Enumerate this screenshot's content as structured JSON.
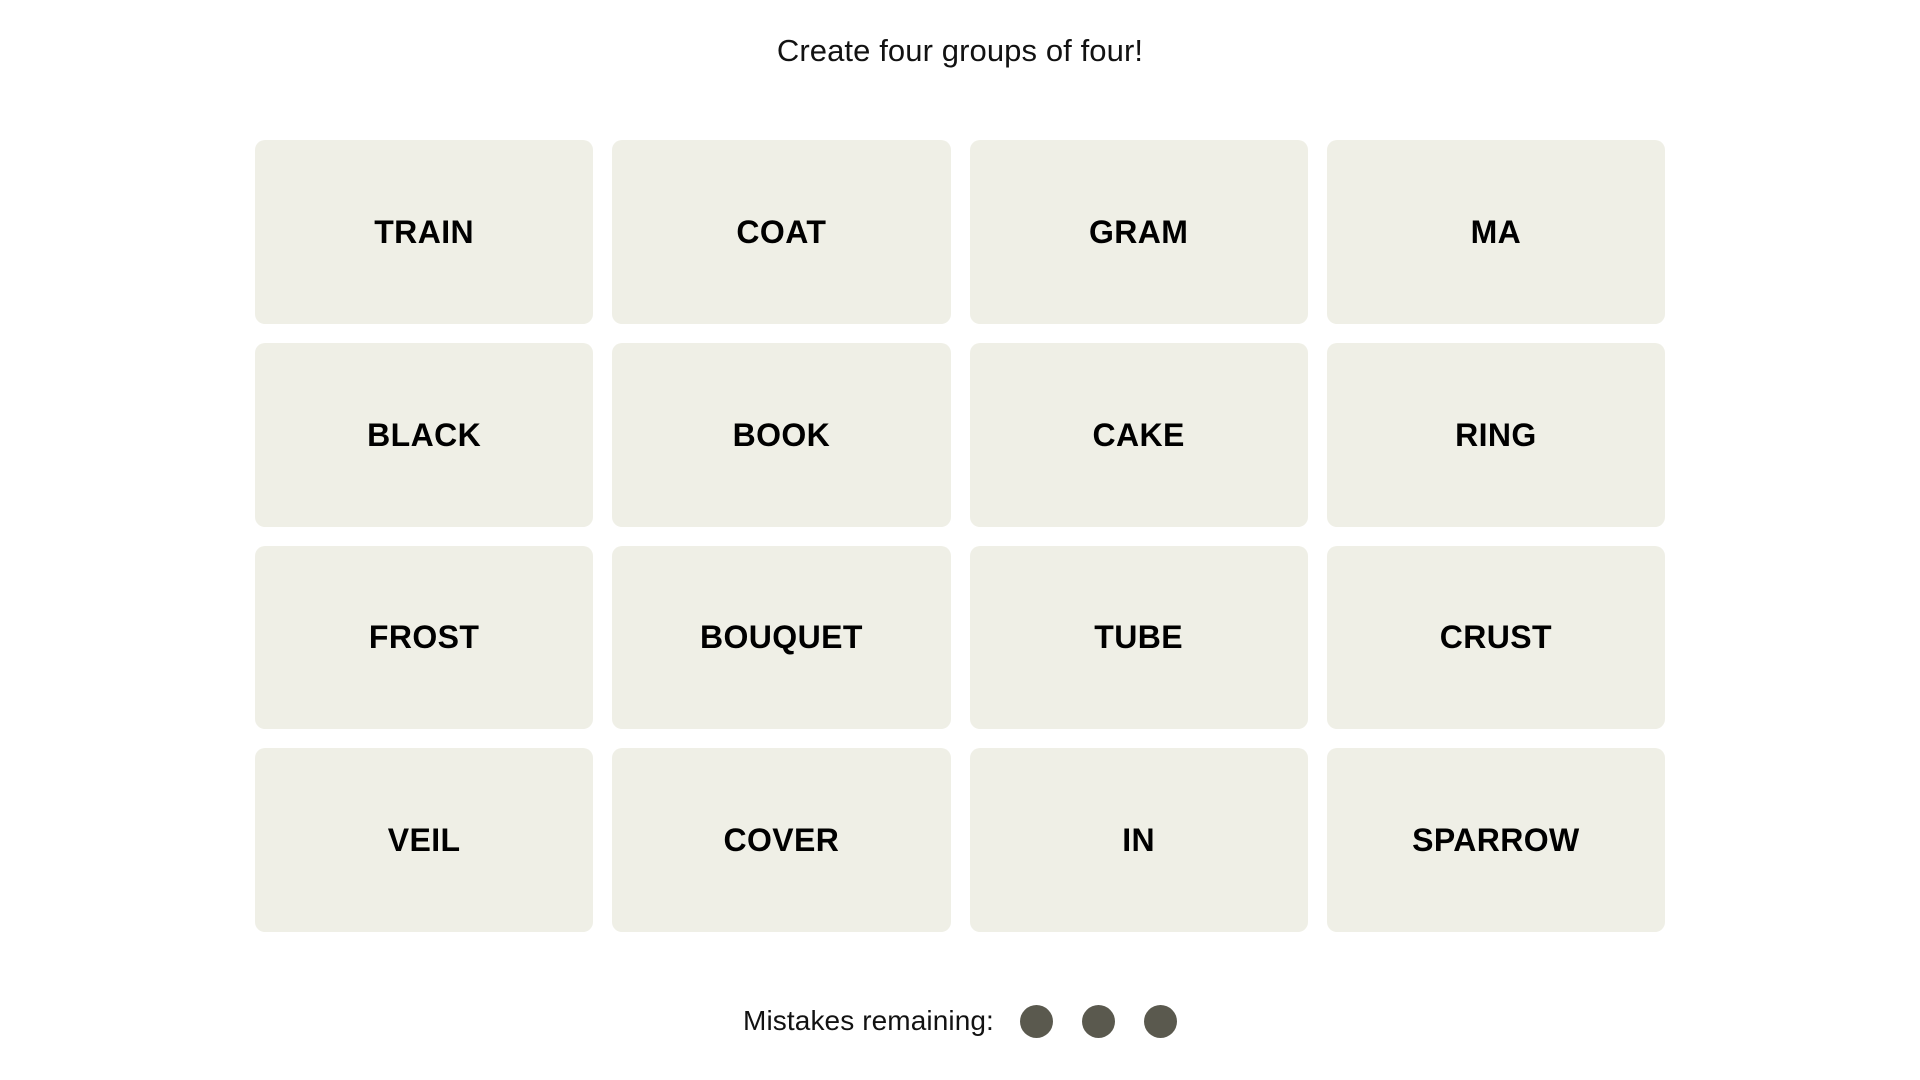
{
  "theme": {
    "page_background": "#ffffff",
    "tile_background": "#efefe6",
    "tile_text_color": "#000000",
    "title_color": "#121212",
    "mistake_dot_color": "#5a594e"
  },
  "header": {
    "title": "Create four groups of four!"
  },
  "board": {
    "rows": 4,
    "columns": 4,
    "tiles": [
      {
        "label": "TRAIN"
      },
      {
        "label": "COAT"
      },
      {
        "label": "GRAM"
      },
      {
        "label": "MA"
      },
      {
        "label": "BLACK"
      },
      {
        "label": "BOOK"
      },
      {
        "label": "CAKE"
      },
      {
        "label": "RING"
      },
      {
        "label": "FROST"
      },
      {
        "label": "BOUQUET"
      },
      {
        "label": "TUBE"
      },
      {
        "label": "CRUST"
      },
      {
        "label": "VEIL"
      },
      {
        "label": "COVER"
      },
      {
        "label": "IN"
      },
      {
        "label": "SPARROW"
      }
    ]
  },
  "footer": {
    "mistakes_label": "Mistakes remaining:",
    "mistakes_remaining": 3,
    "dots": [
      {
        "state": "filled"
      },
      {
        "state": "filled"
      },
      {
        "state": "filled"
      }
    ]
  }
}
